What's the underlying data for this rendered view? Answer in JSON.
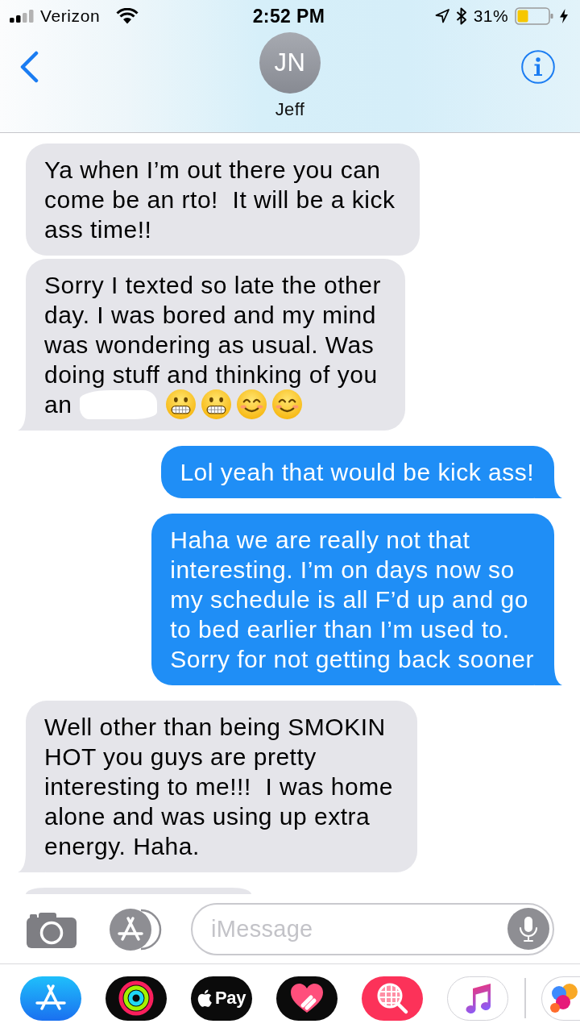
{
  "status_bar": {
    "carrier": "Verizon",
    "time": "2:52 PM",
    "battery": "31%",
    "charging": true
  },
  "header": {
    "initials": "JN",
    "name": "Jeff"
  },
  "messages": [
    {
      "kind": "incoming",
      "tail": false,
      "cut_off": false,
      "redacted": false,
      "text": "Ya when I’m out there you can\ncome be an rto!  It will be a kick\nass time!!"
    },
    {
      "kind": "incoming",
      "tail": true,
      "cut_off": false,
      "redacted": true,
      "text": "Sorry I texted so late the other\nday. I was bored and my mind\nwas wondering as usual. Was\ndoing stuff and thinking of you",
      "fragment": "an",
      "emojis": [
        {
          "kind": "grimacing"
        },
        {
          "kind": "grimacing"
        },
        {
          "kind": "smiling"
        },
        {
          "kind": "smiling"
        }
      ]
    },
    {
      "kind": "outgoing",
      "tail": true,
      "cut_off": false,
      "redacted": false,
      "text": "Lol yeah that would be kick ass!"
    },
    {
      "kind": "outgoing",
      "tail": true,
      "cut_off": false,
      "redacted": false,
      "text": "Haha we are really not that\ninteresting. I’m on days now so\nmy schedule is all F’d up and go\nto bed earlier than I’m used to.\nSorry for not getting back sooner"
    },
    {
      "kind": "incoming",
      "tail": true,
      "cut_off": false,
      "redacted": false,
      "text": "Well other than being SMOKIN\nHOT you guys are pretty\ninteresting to me!!!  I was home\nalone and was using up extra\nenergy. Haha."
    },
    {
      "kind": "incoming",
      "tail": false,
      "cut_off": true,
      "redacted": false
    }
  ],
  "composer": {
    "placeholder": "iMessage"
  },
  "app_drawer": [
    {
      "kind": "store"
    },
    {
      "kind": "activity"
    },
    {
      "kind": "pay",
      "label": "Pay"
    },
    {
      "kind": "heart"
    },
    {
      "kind": "search"
    },
    {
      "kind": "music"
    },
    {
      "kind": "partial"
    }
  ]
}
